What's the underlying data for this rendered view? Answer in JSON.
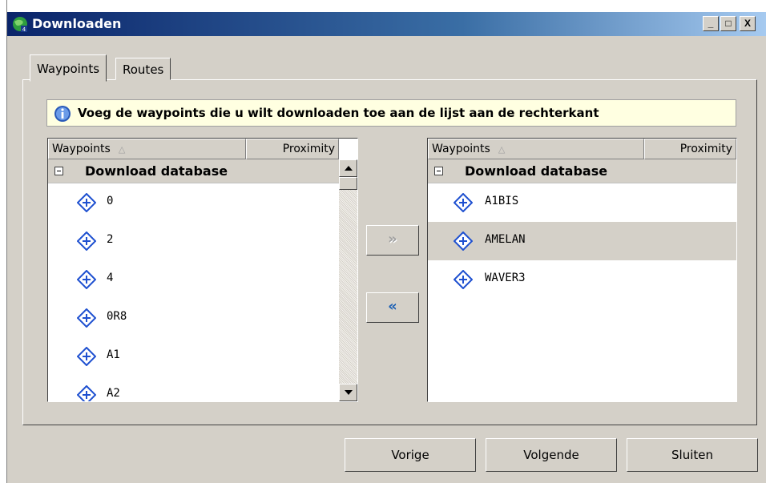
{
  "window": {
    "title": "Downloaden",
    "minimize_label": "_",
    "maximize_label": "□",
    "close_label": "X"
  },
  "tabs": [
    {
      "label": "Waypoints",
      "active": true
    },
    {
      "label": "Routes",
      "active": false
    }
  ],
  "info": {
    "text": "Voeg de waypoints die u wilt downloaden toe aan de lijst aan de rechterkant"
  },
  "left_list": {
    "columns": [
      "Waypoints",
      "Proximity"
    ],
    "sort_indicator": "△",
    "group": "Download database",
    "items": [
      "0",
      "2",
      "4",
      "0R8",
      "A1",
      "A2"
    ]
  },
  "right_list": {
    "columns": [
      "Waypoints",
      "Proximity"
    ],
    "sort_indicator": "△",
    "group": "Download database",
    "items": [
      "A1BIS",
      "AMELAN",
      "WAVER3"
    ],
    "selected_index": 1
  },
  "transfer": {
    "add_label": "»",
    "remove_label": "«"
  },
  "footer": {
    "previous": "Vorige",
    "next": "Volgende",
    "close": "Sluiten"
  },
  "colors": {
    "title_bar_start": "#0a246a",
    "title_bar_end": "#a6caf0",
    "waypoint_icon": "#1e50d0",
    "info_background": "#ffffe1",
    "selection": "#d4d0c8"
  }
}
